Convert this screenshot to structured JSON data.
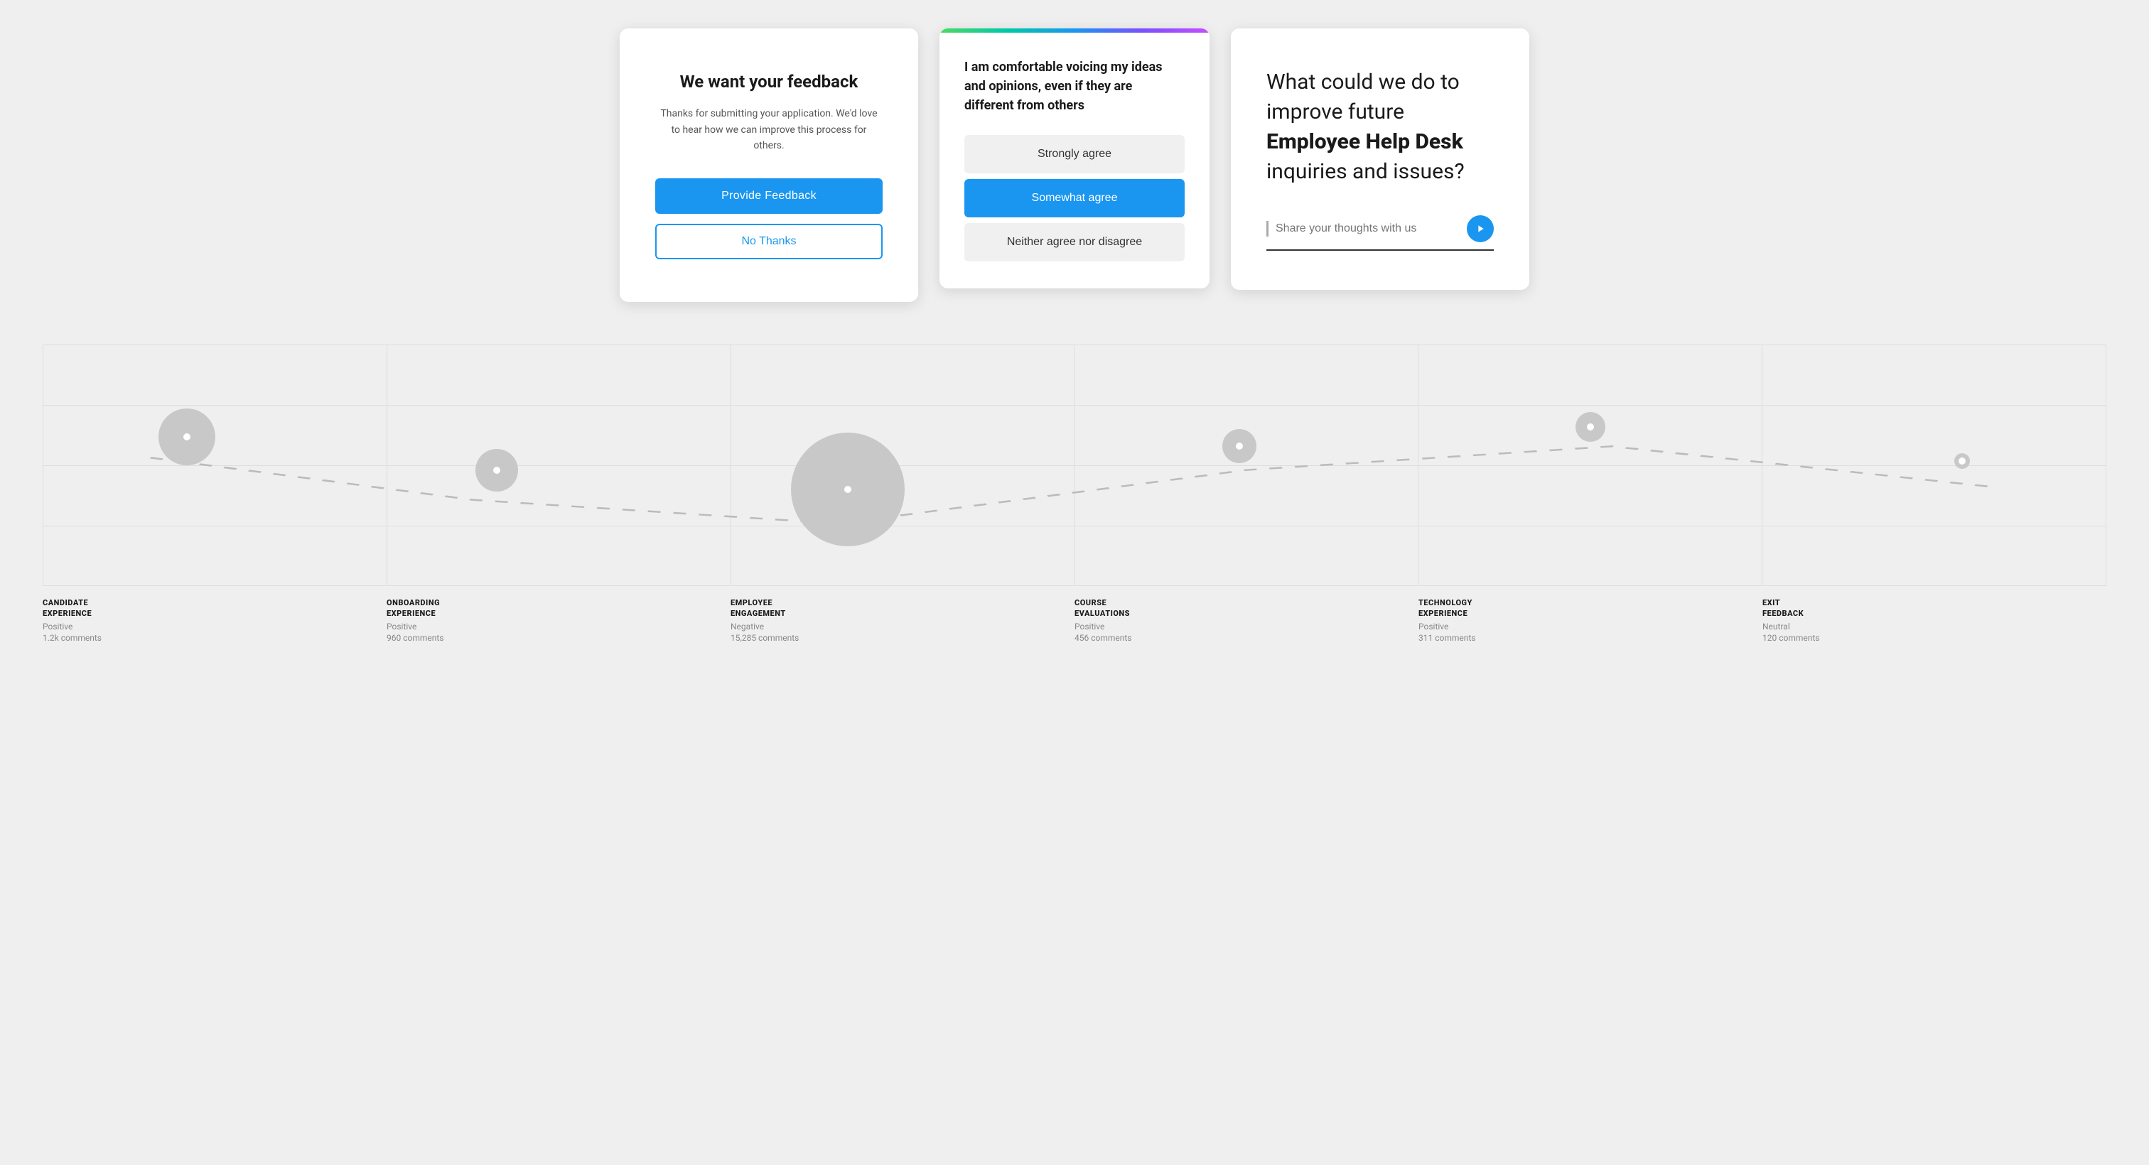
{
  "cards": {
    "card1": {
      "title": "We want your feedback",
      "subtitle": "Thanks for submitting your application. We'd love to hear how we can improve this process for others.",
      "provide_feedback_label": "Provide Feedback",
      "no_thanks_label": "No Thanks"
    },
    "card2": {
      "gradient_colors": [
        "#4cd964",
        "#00c9a7",
        "#1a96f0",
        "#7b4fff",
        "#c44dff"
      ],
      "question": "I am comfortable voicing my ideas and opinions, even if they are different from others",
      "options": [
        {
          "label": "Strongly agree",
          "selected": false
        },
        {
          "label": "Somewhat agree",
          "selected": true
        },
        {
          "label": "Neither agree nor disagree",
          "selected": false
        }
      ]
    },
    "card3": {
      "title_plain": "What could we do to improve future ",
      "title_bold": "Employee Help Desk",
      "title_end": " inquiries and issues?",
      "input_placeholder": "Share your thoughts with us"
    }
  },
  "chart": {
    "categories": [
      {
        "name": "CANDIDATE\nEXPERIENCE",
        "sentiment": "Positive",
        "comments": "1.2k comments",
        "bubble_size": 80,
        "x_pct": 7,
        "y_pct": 38
      },
      {
        "name": "ONBOARDING\nEXPERIENCE",
        "sentiment": "Positive",
        "comments": "960 comments",
        "bubble_size": 60,
        "x_pct": 22,
        "y_pct": 52
      },
      {
        "name": "EMPLOYEE\nENGAGEMENT",
        "sentiment": "Negative",
        "comments": "15,285 comments",
        "bubble_size": 160,
        "x_pct": 39,
        "y_pct": 60
      },
      {
        "name": "COURSE\nEVALUATIONS",
        "sentiment": "Positive",
        "comments": "456 comments",
        "bubble_size": 48,
        "x_pct": 58,
        "y_pct": 42
      },
      {
        "name": "TECHNOLOGY\nEXPERIENCE",
        "sentiment": "Positive",
        "comments": "311 comments",
        "bubble_size": 42,
        "x_pct": 75,
        "y_pct": 34
      },
      {
        "name": "EXIT\nFEEDBACK",
        "sentiment": "Neutral",
        "comments": "120 comments",
        "bubble_size": 22,
        "x_pct": 93,
        "y_pct": 48
      }
    ]
  },
  "colors": {
    "primary_blue": "#1a96f0",
    "bubble_gray": "#c8c8c8",
    "text_dark": "#1a1a1a",
    "text_light": "#888"
  }
}
